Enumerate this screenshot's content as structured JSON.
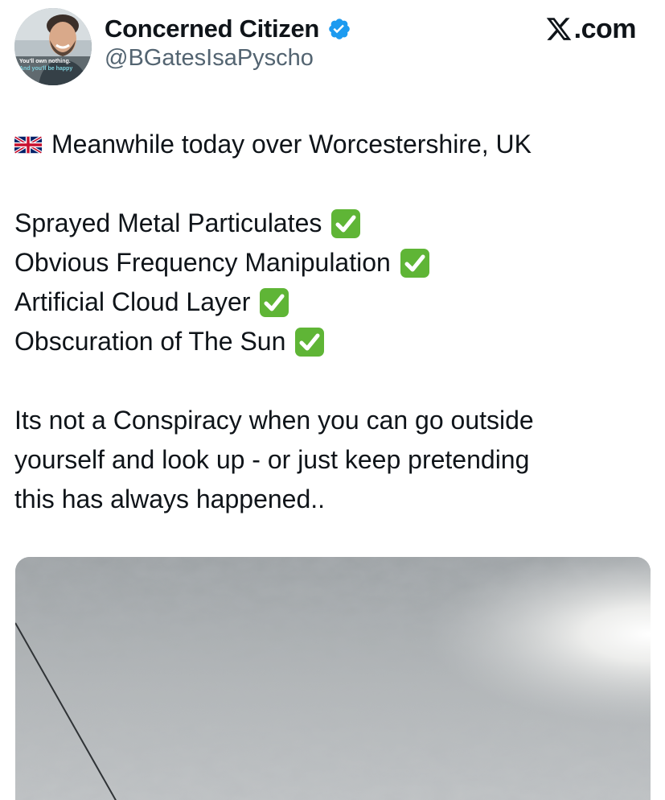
{
  "author": {
    "display_name": "Concerned Citizen",
    "handle": "@BGatesIsaPyscho",
    "verified": true,
    "verified_icon": "verified-badge-icon",
    "verified_color": "#1d9bf0",
    "avatar": {
      "caption_lines": [
        "You'll own nothing.",
        "And you'll be happy"
      ],
      "highlight_color": "#2aa7b8"
    }
  },
  "brand": {
    "icon": "x-logo-icon",
    "text": ".com"
  },
  "tweet": {
    "flag_icon": "uk-flag-icon",
    "intro": "Meanwhile today over Worcestershire, UK",
    "checklist": [
      "Sprayed Metal Particulates",
      "Obvious Frequency Manipulation",
      "Artificial Cloud Layer",
      "Obscuration of The Sun"
    ],
    "check_icon": "white-check-mark-icon",
    "check_color": "#5fb536",
    "closing_lines": [
      "Its not a Conspiracy when you can go outside",
      "yourself and look up - or just keep pretending",
      "this has always happened.."
    ]
  },
  "media": {
    "description_icon": "cloudy-sky-photo",
    "sky_color": "#a9adaf"
  }
}
